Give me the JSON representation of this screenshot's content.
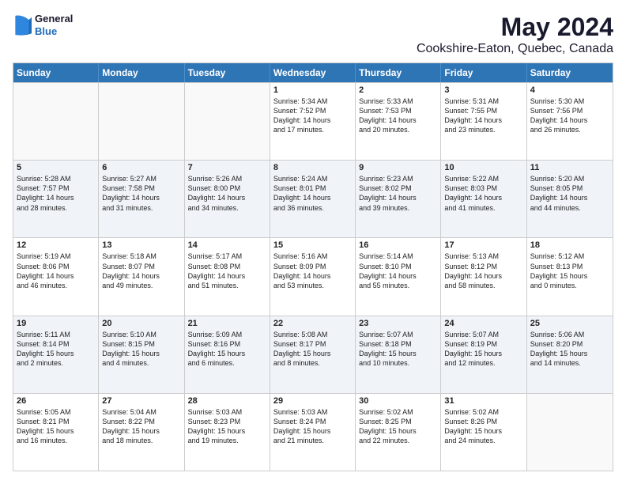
{
  "logo": {
    "general": "General",
    "blue": "Blue"
  },
  "title": "May 2024",
  "subtitle": "Cookshire-Eaton, Quebec, Canada",
  "weekdays": [
    "Sunday",
    "Monday",
    "Tuesday",
    "Wednesday",
    "Thursday",
    "Friday",
    "Saturday"
  ],
  "rows": [
    {
      "alt": false,
      "cells": [
        {
          "day": "",
          "empty": true,
          "lines": []
        },
        {
          "day": "",
          "empty": true,
          "lines": []
        },
        {
          "day": "",
          "empty": true,
          "lines": []
        },
        {
          "day": "1",
          "empty": false,
          "lines": [
            "Sunrise: 5:34 AM",
            "Sunset: 7:52 PM",
            "Daylight: 14 hours",
            "and 17 minutes."
          ]
        },
        {
          "day": "2",
          "empty": false,
          "lines": [
            "Sunrise: 5:33 AM",
            "Sunset: 7:53 PM",
            "Daylight: 14 hours",
            "and 20 minutes."
          ]
        },
        {
          "day": "3",
          "empty": false,
          "lines": [
            "Sunrise: 5:31 AM",
            "Sunset: 7:55 PM",
            "Daylight: 14 hours",
            "and 23 minutes."
          ]
        },
        {
          "day": "4",
          "empty": false,
          "lines": [
            "Sunrise: 5:30 AM",
            "Sunset: 7:56 PM",
            "Daylight: 14 hours",
            "and 26 minutes."
          ]
        }
      ]
    },
    {
      "alt": true,
      "cells": [
        {
          "day": "5",
          "empty": false,
          "lines": [
            "Sunrise: 5:28 AM",
            "Sunset: 7:57 PM",
            "Daylight: 14 hours",
            "and 28 minutes."
          ]
        },
        {
          "day": "6",
          "empty": false,
          "lines": [
            "Sunrise: 5:27 AM",
            "Sunset: 7:58 PM",
            "Daylight: 14 hours",
            "and 31 minutes."
          ]
        },
        {
          "day": "7",
          "empty": false,
          "lines": [
            "Sunrise: 5:26 AM",
            "Sunset: 8:00 PM",
            "Daylight: 14 hours",
            "and 34 minutes."
          ]
        },
        {
          "day": "8",
          "empty": false,
          "lines": [
            "Sunrise: 5:24 AM",
            "Sunset: 8:01 PM",
            "Daylight: 14 hours",
            "and 36 minutes."
          ]
        },
        {
          "day": "9",
          "empty": false,
          "lines": [
            "Sunrise: 5:23 AM",
            "Sunset: 8:02 PM",
            "Daylight: 14 hours",
            "and 39 minutes."
          ]
        },
        {
          "day": "10",
          "empty": false,
          "lines": [
            "Sunrise: 5:22 AM",
            "Sunset: 8:03 PM",
            "Daylight: 14 hours",
            "and 41 minutes."
          ]
        },
        {
          "day": "11",
          "empty": false,
          "lines": [
            "Sunrise: 5:20 AM",
            "Sunset: 8:05 PM",
            "Daylight: 14 hours",
            "and 44 minutes."
          ]
        }
      ]
    },
    {
      "alt": false,
      "cells": [
        {
          "day": "12",
          "empty": false,
          "lines": [
            "Sunrise: 5:19 AM",
            "Sunset: 8:06 PM",
            "Daylight: 14 hours",
            "and 46 minutes."
          ]
        },
        {
          "day": "13",
          "empty": false,
          "lines": [
            "Sunrise: 5:18 AM",
            "Sunset: 8:07 PM",
            "Daylight: 14 hours",
            "and 49 minutes."
          ]
        },
        {
          "day": "14",
          "empty": false,
          "lines": [
            "Sunrise: 5:17 AM",
            "Sunset: 8:08 PM",
            "Daylight: 14 hours",
            "and 51 minutes."
          ]
        },
        {
          "day": "15",
          "empty": false,
          "lines": [
            "Sunrise: 5:16 AM",
            "Sunset: 8:09 PM",
            "Daylight: 14 hours",
            "and 53 minutes."
          ]
        },
        {
          "day": "16",
          "empty": false,
          "lines": [
            "Sunrise: 5:14 AM",
            "Sunset: 8:10 PM",
            "Daylight: 14 hours",
            "and 55 minutes."
          ]
        },
        {
          "day": "17",
          "empty": false,
          "lines": [
            "Sunrise: 5:13 AM",
            "Sunset: 8:12 PM",
            "Daylight: 14 hours",
            "and 58 minutes."
          ]
        },
        {
          "day": "18",
          "empty": false,
          "lines": [
            "Sunrise: 5:12 AM",
            "Sunset: 8:13 PM",
            "Daylight: 15 hours",
            "and 0 minutes."
          ]
        }
      ]
    },
    {
      "alt": true,
      "cells": [
        {
          "day": "19",
          "empty": false,
          "lines": [
            "Sunrise: 5:11 AM",
            "Sunset: 8:14 PM",
            "Daylight: 15 hours",
            "and 2 minutes."
          ]
        },
        {
          "day": "20",
          "empty": false,
          "lines": [
            "Sunrise: 5:10 AM",
            "Sunset: 8:15 PM",
            "Daylight: 15 hours",
            "and 4 minutes."
          ]
        },
        {
          "day": "21",
          "empty": false,
          "lines": [
            "Sunrise: 5:09 AM",
            "Sunset: 8:16 PM",
            "Daylight: 15 hours",
            "and 6 minutes."
          ]
        },
        {
          "day": "22",
          "empty": false,
          "lines": [
            "Sunrise: 5:08 AM",
            "Sunset: 8:17 PM",
            "Daylight: 15 hours",
            "and 8 minutes."
          ]
        },
        {
          "day": "23",
          "empty": false,
          "lines": [
            "Sunrise: 5:07 AM",
            "Sunset: 8:18 PM",
            "Daylight: 15 hours",
            "and 10 minutes."
          ]
        },
        {
          "day": "24",
          "empty": false,
          "lines": [
            "Sunrise: 5:07 AM",
            "Sunset: 8:19 PM",
            "Daylight: 15 hours",
            "and 12 minutes."
          ]
        },
        {
          "day": "25",
          "empty": false,
          "lines": [
            "Sunrise: 5:06 AM",
            "Sunset: 8:20 PM",
            "Daylight: 15 hours",
            "and 14 minutes."
          ]
        }
      ]
    },
    {
      "alt": false,
      "cells": [
        {
          "day": "26",
          "empty": false,
          "lines": [
            "Sunrise: 5:05 AM",
            "Sunset: 8:21 PM",
            "Daylight: 15 hours",
            "and 16 minutes."
          ]
        },
        {
          "day": "27",
          "empty": false,
          "lines": [
            "Sunrise: 5:04 AM",
            "Sunset: 8:22 PM",
            "Daylight: 15 hours",
            "and 18 minutes."
          ]
        },
        {
          "day": "28",
          "empty": false,
          "lines": [
            "Sunrise: 5:03 AM",
            "Sunset: 8:23 PM",
            "Daylight: 15 hours",
            "and 19 minutes."
          ]
        },
        {
          "day": "29",
          "empty": false,
          "lines": [
            "Sunrise: 5:03 AM",
            "Sunset: 8:24 PM",
            "Daylight: 15 hours",
            "and 21 minutes."
          ]
        },
        {
          "day": "30",
          "empty": false,
          "lines": [
            "Sunrise: 5:02 AM",
            "Sunset: 8:25 PM",
            "Daylight: 15 hours",
            "and 22 minutes."
          ]
        },
        {
          "day": "31",
          "empty": false,
          "lines": [
            "Sunrise: 5:02 AM",
            "Sunset: 8:26 PM",
            "Daylight: 15 hours",
            "and 24 minutes."
          ]
        },
        {
          "day": "",
          "empty": true,
          "lines": []
        }
      ]
    }
  ]
}
